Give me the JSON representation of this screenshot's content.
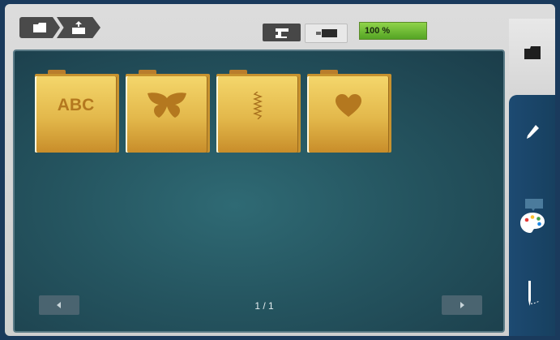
{
  "topbar": {
    "breadcrumbs": [
      {
        "icon": "folder-icon"
      },
      {
        "icon": "upload-folder-icon"
      }
    ],
    "modes": [
      {
        "icon": "sewing-machine-icon",
        "active": true
      },
      {
        "icon": "embroidery-unit-icon",
        "active": false
      }
    ],
    "progress": {
      "label": "100 %",
      "value": 100,
      "color": "#6cbf34"
    }
  },
  "folders": [
    {
      "name": "abc",
      "label": "ABC",
      "icon": "abc-text"
    },
    {
      "name": "butterfly",
      "label": "",
      "icon": "butterfly-icon"
    },
    {
      "name": "stitch",
      "label": "",
      "icon": "zigzag-stitch-icon"
    },
    {
      "name": "heart",
      "label": "",
      "icon": "heart-icon"
    }
  ],
  "pagination": {
    "page_label": "1 / 1",
    "prev_icon": "arrow-left-icon",
    "next_icon": "arrow-right-icon"
  },
  "sidebar": {
    "items": [
      {
        "icon": "folder-icon",
        "active": true
      },
      {
        "icon": "pencil-icon",
        "active": false
      },
      {
        "icon": "color-palette-icon",
        "active": false
      },
      {
        "icon": "needle-thread-icon",
        "active": false
      }
    ]
  },
  "colors": {
    "folder": "#e3b84b",
    "panel": "#255560",
    "rail": "#1d4a72",
    "accent": "#6cbf34"
  }
}
